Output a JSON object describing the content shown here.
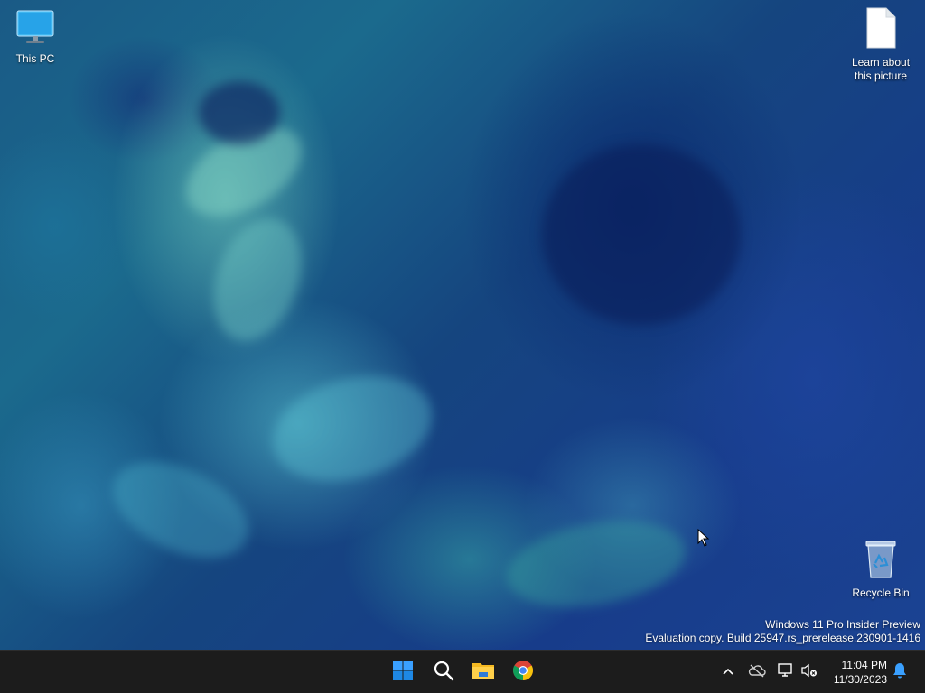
{
  "desktop": {
    "icons": {
      "this_pc": "This PC",
      "learn_about": "Learn about\nthis picture",
      "recycle_bin": "Recycle Bin"
    },
    "watermark": {
      "line1": "Windows 11 Pro Insider Preview",
      "line2": "Evaluation copy. Build 25947.rs_prerelease.230901-1416"
    }
  },
  "taskbar": {
    "apps": [
      "start-icon",
      "search-icon",
      "file-explorer-icon",
      "chrome-icon"
    ],
    "tray": [
      "chevron-up-icon",
      "onedrive-icon",
      "network-icon",
      "volume-muted-icon",
      "notification-bell-icon"
    ],
    "clock": {
      "time": "11:04 PM",
      "date": "11/30/2023"
    }
  },
  "colors": {
    "taskbar": "#1c1c1c",
    "start_blue": "#1e90ff",
    "bell_blue": "#3aa0ff"
  }
}
